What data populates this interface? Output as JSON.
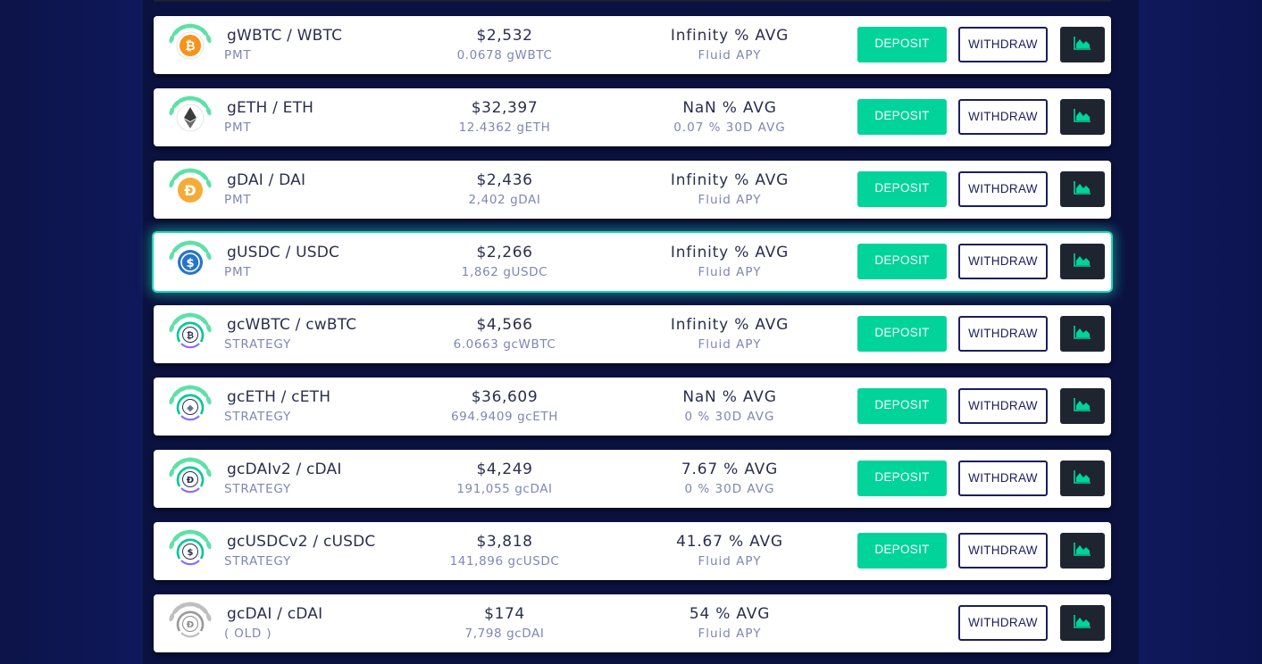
{
  "colors": {
    "accent": "#00d49a",
    "dark_button": "#1f2530",
    "navy": "#1a1f5c",
    "highlight": "#1fd4b4"
  },
  "buttons": {
    "deposit_label": "DEPOSIT",
    "withdraw_label": "WITHDRAW",
    "chart_icon": "area-chart-icon"
  },
  "pools": [
    {
      "name": "gWBTC / WBTC",
      "sub": "PMT",
      "usd": "$2,532",
      "balance": "0.0678 gWBTC",
      "apy": "Infinity % AVG",
      "apy_sub": "Fluid APY",
      "coin": "btc",
      "coin_color": "#f7931a",
      "laurel": "green",
      "has_deposit": true,
      "highlighted": false
    },
    {
      "name": "gETH / ETH",
      "sub": "PMT",
      "usd": "$32,397",
      "balance": "12.4362 gETH",
      "apy": "NaN % AVG",
      "apy_sub": "0.07 % 30D AVG",
      "coin": "eth",
      "coin_color": "#3c3c3d",
      "laurel": "green",
      "has_deposit": true,
      "highlighted": false
    },
    {
      "name": "gDAI / DAI",
      "sub": "PMT",
      "usd": "$2,436",
      "balance": "2,402 gDAI",
      "apy": "Infinity % AVG",
      "apy_sub": "Fluid APY",
      "coin": "dai",
      "coin_color": "#f5ac37",
      "laurel": "green",
      "has_deposit": true,
      "highlighted": false
    },
    {
      "name": "gUSDC / USDC",
      "sub": "PMT",
      "usd": "$2,266",
      "balance": "1,862 gUSDC",
      "apy": "Infinity % AVG",
      "apy_sub": "Fluid APY",
      "coin": "usdc",
      "coin_color": "#2775ca",
      "laurel": "green",
      "has_deposit": true,
      "highlighted": true
    },
    {
      "name": "gcWBTC / cwBTC",
      "sub": "STRATEGY",
      "usd": "$4,566",
      "balance": "6.0663 gcWBTC",
      "apy": "Infinity % AVG",
      "apy_sub": "Fluid APY",
      "coin": "cbtc",
      "coin_color": "#ffffff",
      "laurel": "green",
      "has_deposit": true,
      "highlighted": false
    },
    {
      "name": "gcETH / cETH",
      "sub": "STRATEGY",
      "usd": "$36,609",
      "balance": "694.9409 gcETH",
      "apy": "NaN % AVG",
      "apy_sub": "0 % 30D AVG",
      "coin": "ceth",
      "coin_color": "#ffffff",
      "laurel": "green",
      "has_deposit": true,
      "highlighted": false
    },
    {
      "name": "gcDAIv2 / cDAI",
      "sub": "STRATEGY",
      "usd": "$4,249",
      "balance": "191,055 gcDAI",
      "apy": "7.67 % AVG",
      "apy_sub": "0 % 30D AVG",
      "coin": "cdai",
      "coin_color": "#ffffff",
      "laurel": "green",
      "has_deposit": true,
      "highlighted": false
    },
    {
      "name": "gcUSDCv2 / cUSDC",
      "sub": "STRATEGY",
      "usd": "$3,818",
      "balance": "141,896 gcUSDC",
      "apy": "41.67 % AVG",
      "apy_sub": "Fluid APY",
      "coin": "cusdc",
      "coin_color": "#ffffff",
      "laurel": "green",
      "has_deposit": true,
      "highlighted": false
    },
    {
      "name": "gcDAI / cDAI",
      "sub": "( OLD )",
      "usd": "$174",
      "balance": "7,798 gcDAI",
      "apy": "54 % AVG",
      "apy_sub": "Fluid APY",
      "coin": "cdai-old",
      "coin_color": "#ffffff",
      "laurel": "grey",
      "has_deposit": false,
      "highlighted": false
    }
  ]
}
